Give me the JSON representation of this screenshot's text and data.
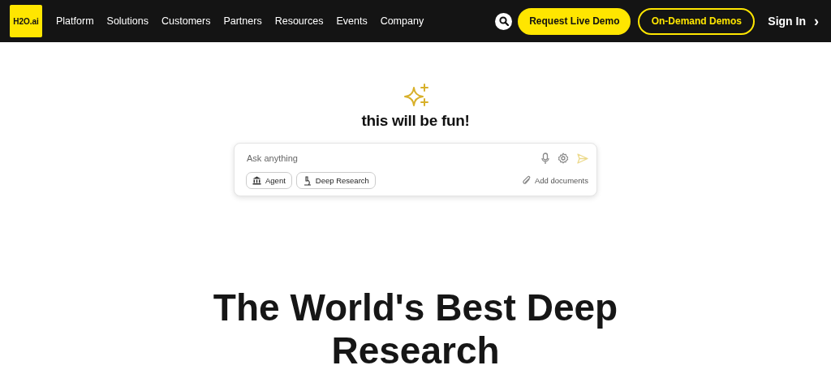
{
  "nav": {
    "logo": "H2O.ai",
    "links": [
      "Platform",
      "Solutions",
      "Customers",
      "Partners",
      "Resources",
      "Events",
      "Company"
    ],
    "demo_button": "Request Live Demo",
    "ondemand_button": "On-Demand Demos",
    "sign_in": "Sign In",
    "sign_in_arrow": "›"
  },
  "hero": {
    "tagline": "this will be fun!"
  },
  "prompt": {
    "placeholder": "Ask anything",
    "send_disabled": true,
    "chips": [
      {
        "label": "Agent",
        "kind": "agent"
      },
      {
        "label": "Deep Research",
        "kind": "research"
      }
    ],
    "attach": "Add documents"
  },
  "headline": "The World's Best Deep Research"
}
